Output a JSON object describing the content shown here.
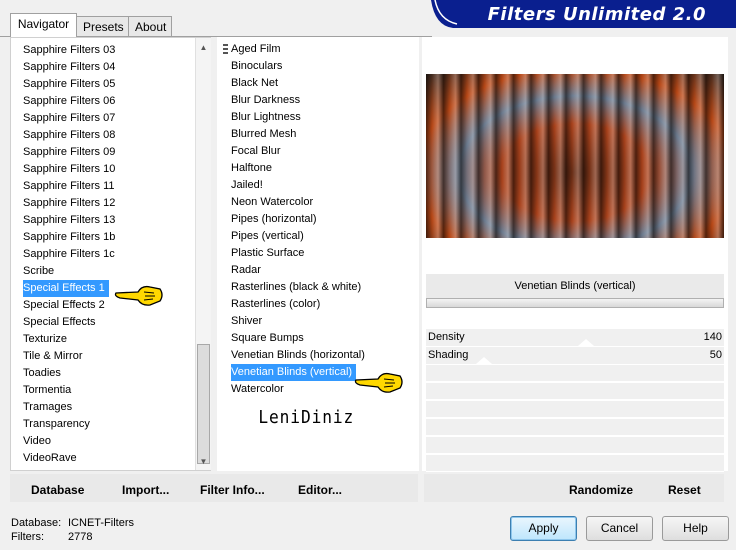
{
  "tabs": [
    {
      "label": "Navigator"
    },
    {
      "label": "Presets"
    },
    {
      "label": "About"
    }
  ],
  "logo": {
    "text": "Filters Unlimited 2.0"
  },
  "categories": {
    "items": [
      "Sapphire Filters 03",
      "Sapphire Filters 04",
      "Sapphire Filters 05",
      "Sapphire Filters 06",
      "Sapphire Filters 07",
      "Sapphire Filters 08",
      "Sapphire Filters 09",
      "Sapphire Filters 10",
      "Sapphire Filters 11",
      "Sapphire Filters 12",
      "Sapphire Filters 13",
      "Sapphire Filters 1b",
      "Sapphire Filters 1c",
      "Scribe",
      "Special Effects 1",
      "Special Effects 2",
      "Special Effects",
      "Texturize",
      "Tile & Mirror",
      "Toadies",
      "Tormentia",
      "Tramages",
      "Transparency",
      "Video",
      "VideoRave"
    ],
    "selected": "Special Effects 1"
  },
  "filters": {
    "items": [
      "Aged Film",
      "Binoculars",
      "Black Net",
      "Blur Darkness",
      "Blur Lightness",
      "Blurred Mesh",
      "Focal Blur",
      "Halftone",
      "Jailed!",
      "Neon Watercolor",
      "Pipes (horizontal)",
      "Pipes (vertical)",
      "Plastic Surface",
      "Radar",
      "Rasterlines (black & white)",
      "Rasterlines (color)",
      "Shiver",
      "Square Bumps",
      "Venetian Blinds (horizontal)",
      "Venetian Blinds (vertical)",
      "Watercolor"
    ],
    "selected": "Venetian Blinds (vertical)",
    "watermark": "LeniDiniz"
  },
  "preview": {
    "filter_name": "Venetian Blinds (vertical)",
    "params": [
      {
        "label": "Density",
        "value": "140",
        "level": 0.55
      },
      {
        "label": "Shading",
        "value": "50",
        "level": 0.2
      }
    ]
  },
  "left_buttons": {
    "database": "Database",
    "import": "Import...",
    "filter_info": "Filter Info...",
    "editor": "Editor..."
  },
  "right_buttons": {
    "randomize": "Randomize",
    "reset": "Reset"
  },
  "status": {
    "database_label": "Database:",
    "database_value": "ICNET-Filters",
    "filters_label": "Filters:",
    "filters_value": "2778"
  },
  "dialog_buttons": {
    "apply": "Apply",
    "cancel": "Cancel",
    "help": "Help"
  },
  "colors": {
    "selection": "#3399ff",
    "logo_bg": "#0a1f8f",
    "hand": "#ffd800"
  }
}
